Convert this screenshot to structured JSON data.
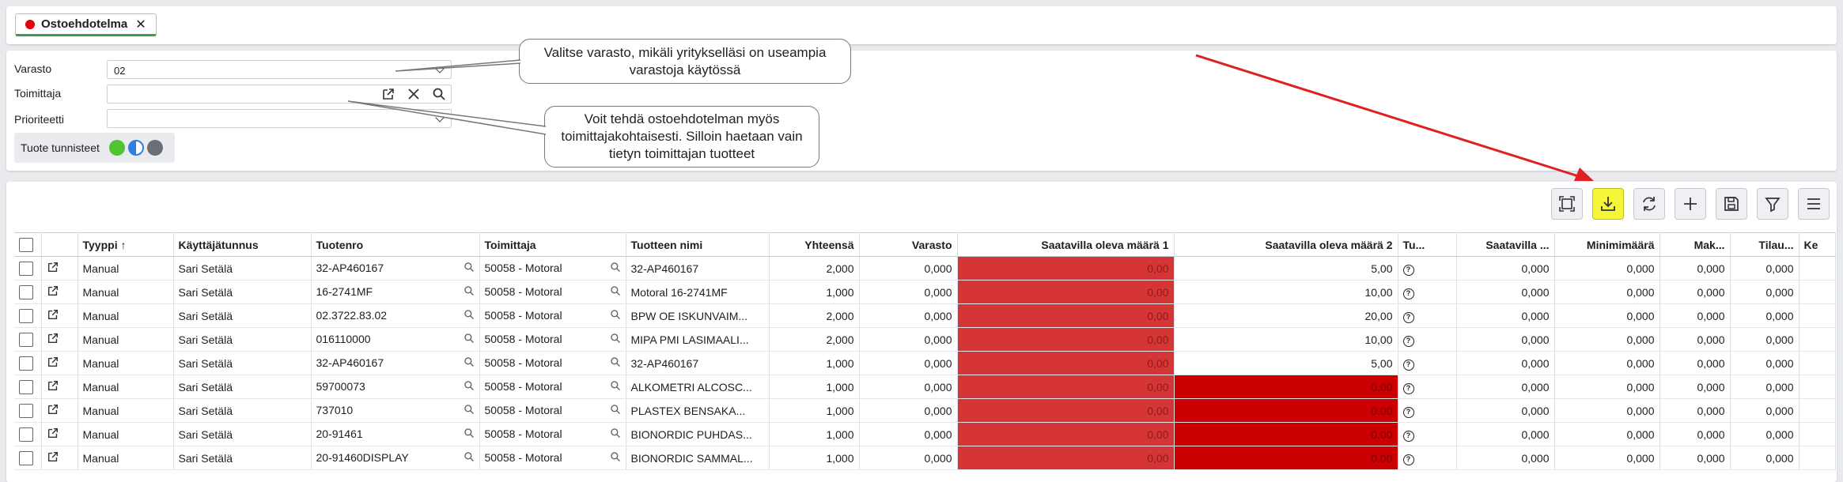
{
  "tab": {
    "label": "Ostoehdotelma",
    "close": "✕"
  },
  "filters": {
    "varasto_label": "Varasto",
    "varasto_value": "02",
    "toimittaja_label": "Toimittaja",
    "toimittaja_value": "",
    "prioriteetti_label": "Prioriteetti",
    "prioriteetti_value": "",
    "tags_label": "Tuote tunnisteet"
  },
  "colors": {
    "accent_green": "#3a9e4a",
    "tag_green": "#4fc432",
    "tag_blue": "#2f7fe0",
    "tag_gray": "#6b6f75",
    "highlight": "#f5f53a",
    "cell_red_light": "#d63535",
    "cell_red_dark": "#cc0000",
    "arrow": "#e02020"
  },
  "callouts": {
    "varasto_hint": "Valitse varasto, mikäli yritykselläsi on useampia varastoja käytössä",
    "toimittaja_hint": "Voit tehdä ostoehdotelman myös toimittajakohtaisesti. Silloin haetaan vain tietyn toimittajan tuotteet"
  },
  "toolbar": [
    "fit-icon",
    "download-icon",
    "refresh-icon",
    "plus-icon",
    "save-icon",
    "filter-icon",
    "menu-icon"
  ],
  "columns": [
    "Tyyppi ↑",
    "Käyttäjätunnus",
    "Tuotenro",
    "Toimittaja",
    "Tuotteen nimi",
    "Yhteensä",
    "Varasto",
    "Saatavilla oleva määrä 1",
    "Saatavilla oleva määrä 2",
    "Tu...",
    "Saatavilla ...",
    "Minimimäärä",
    "Mak...",
    "Tilau...",
    "Ke"
  ],
  "rows": [
    [
      "Manual",
      "Sari Setälä",
      "32-AP460167",
      "50058 - Motoral",
      "32-AP460167",
      "2,000",
      "0,000",
      "0,00",
      "5,00",
      "0,000",
      "0,000",
      "0,000",
      "0,000"
    ],
    [
      "Manual",
      "Sari Setälä",
      "16-2741MF",
      "50058 - Motoral",
      "Motoral 16-2741MF",
      "1,000",
      "0,000",
      "0,00",
      "10,00",
      "0,000",
      "0,000",
      "0,000",
      "0,000"
    ],
    [
      "Manual",
      "Sari Setälä",
      "02.3722.83.02",
      "50058 - Motoral",
      "BPW OE ISKUNVAIM...",
      "2,000",
      "0,000",
      "0,00",
      "20,00",
      "0,000",
      "0,000",
      "0,000",
      "0,000"
    ],
    [
      "Manual",
      "Sari Setälä",
      "016110000",
      "50058 - Motoral",
      "MIPA PMI LASIMAALI...",
      "2,000",
      "0,000",
      "0,00",
      "10,00",
      "0,000",
      "0,000",
      "0,000",
      "0,000"
    ],
    [
      "Manual",
      "Sari Setälä",
      "32-AP460167",
      "50058 - Motoral",
      "32-AP460167",
      "1,000",
      "0,000",
      "0,00",
      "5,00",
      "0,000",
      "0,000",
      "0,000",
      "0,000"
    ],
    [
      "Manual",
      "Sari Setälä",
      "59700073",
      "50058 - Motoral",
      "ALKOMETRI ALCOSC...",
      "1,000",
      "0,000",
      "0,00",
      "0,00",
      "0,000",
      "0,000",
      "0,000",
      "0,000"
    ],
    [
      "Manual",
      "Sari Setälä",
      "737010",
      "50058 - Motoral",
      "PLASTEX BENSAKA...",
      "1,000",
      "0,000",
      "0,00",
      "0,00",
      "0,000",
      "0,000",
      "0,000",
      "0,000"
    ],
    [
      "Manual",
      "Sari Setälä",
      "20-91461",
      "50058 - Motoral",
      "BIONORDIC PUHDAS...",
      "1,000",
      "0,000",
      "0,00",
      "0,00",
      "0,000",
      "0,000",
      "0,000",
      "0,000"
    ],
    [
      "Manual",
      "Sari Setälä",
      "20-91460DISPLAY",
      "50058 - Motoral",
      "BIONORDIC SAMMAL...",
      "1,000",
      "0,000",
      "0,00",
      "0,00",
      "0,000",
      "0,000",
      "0,000",
      "0,000"
    ]
  ]
}
